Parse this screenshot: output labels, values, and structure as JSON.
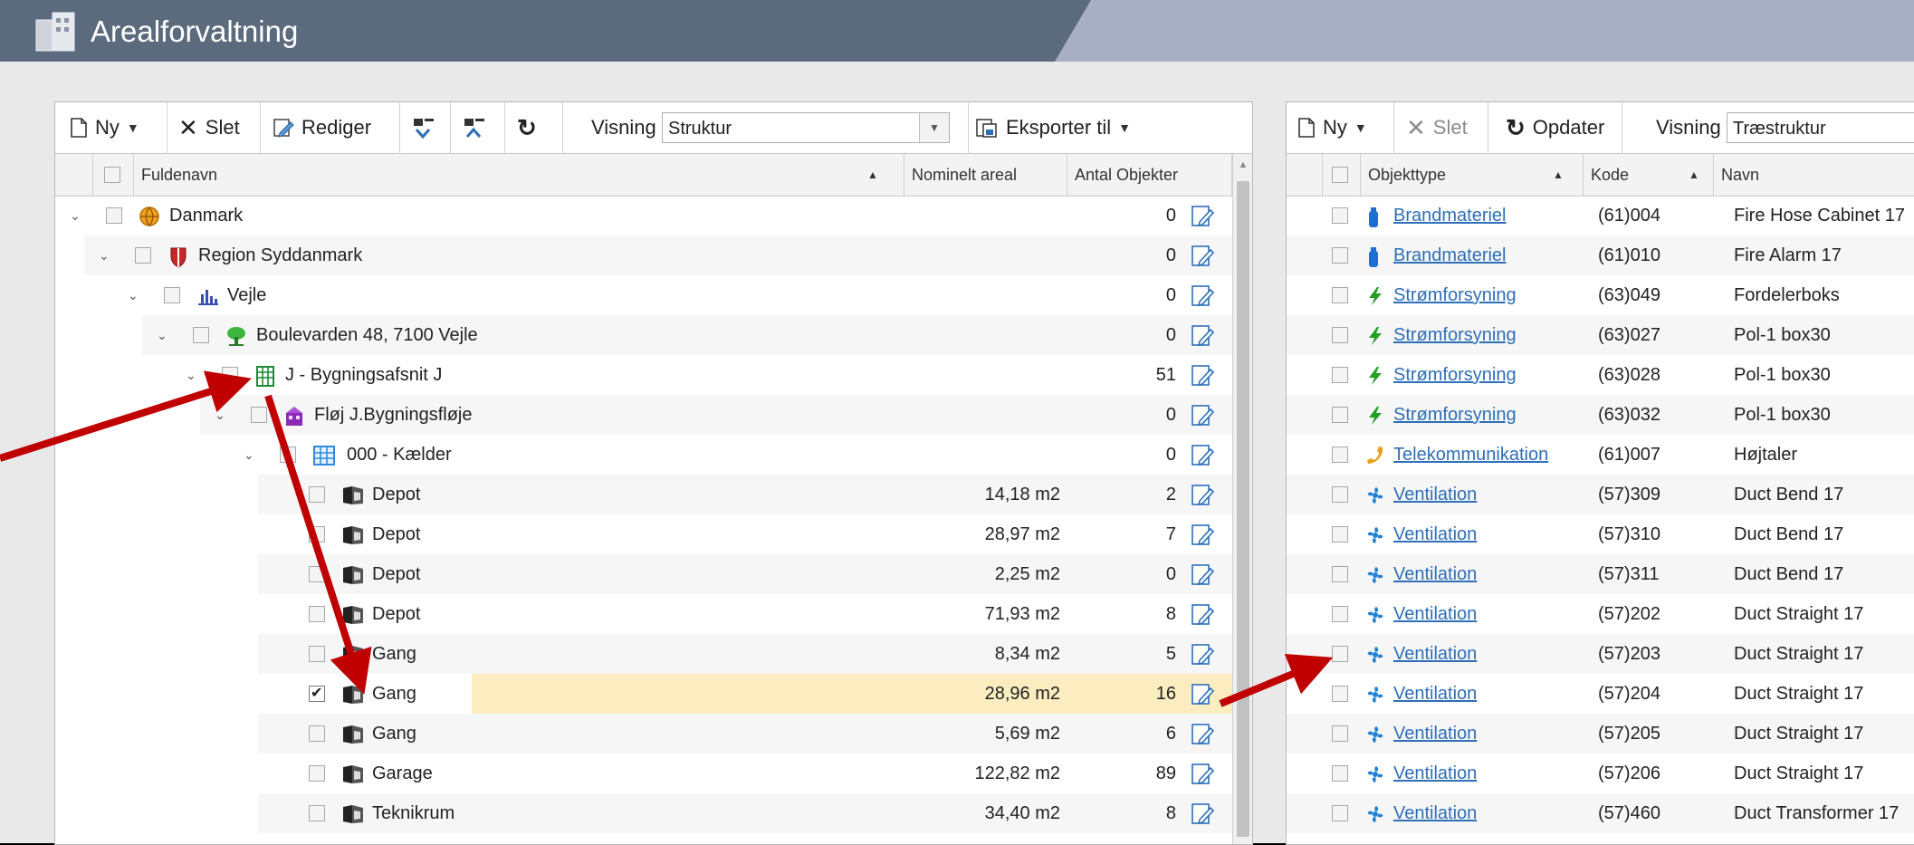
{
  "app": {
    "title": "Arealforvaltning"
  },
  "left_toolbar": {
    "new_label": "Ny",
    "delete_label": "Slet",
    "edit_label": "Rediger",
    "view_label": "Visning",
    "view_value": "Struktur",
    "export_label": "Eksporter til"
  },
  "left_table": {
    "columns": [
      "Fuldenavn",
      "Nominelt areal",
      "Antal Objekter"
    ],
    "rows": [
      {
        "name": "Danmark",
        "area": "",
        "count": "0",
        "icon": "globe-icon",
        "checked": false
      },
      {
        "name": "Region Syddanmark",
        "area": "",
        "count": "0",
        "icon": "shield-icon",
        "checked": false
      },
      {
        "name": "Vejle",
        "area": "",
        "count": "0",
        "icon": "city-icon",
        "checked": false
      },
      {
        "name": "Boulevarden 48, 7100 Vejle",
        "area": "",
        "count": "0",
        "icon": "tree-icon",
        "checked": false
      },
      {
        "name": "J - Bygningsafsnit J",
        "area": "",
        "count": "51",
        "icon": "building-icon",
        "checked": false
      },
      {
        "name": "Fløj J.Bygningsfløje",
        "area": "",
        "count": "0",
        "icon": "wing-icon",
        "checked": false
      },
      {
        "name": "000 - Kælder",
        "area": "",
        "count": "0",
        "icon": "floor-icon",
        "checked": false
      },
      {
        "name": "Depot",
        "area": "14,18 m2",
        "count": "2",
        "icon": "room-icon",
        "checked": false
      },
      {
        "name": "Depot",
        "area": "28,97 m2",
        "count": "7",
        "icon": "room-icon",
        "checked": false
      },
      {
        "name": "Depot",
        "area": "2,25 m2",
        "count": "0",
        "icon": "room-icon",
        "checked": false
      },
      {
        "name": "Depot",
        "area": "71,93 m2",
        "count": "8",
        "icon": "room-icon",
        "checked": false
      },
      {
        "name": "Gang",
        "area": "8,34 m2",
        "count": "5",
        "icon": "room-icon",
        "checked": false
      },
      {
        "name": "Gang",
        "area": "28,96 m2",
        "count": "16",
        "icon": "room-icon",
        "checked": true
      },
      {
        "name": "Gang",
        "area": "5,69 m2",
        "count": "6",
        "icon": "room-icon",
        "checked": false
      },
      {
        "name": "Garage",
        "area": "122,82 m2",
        "count": "89",
        "icon": "room-icon",
        "checked": false
      },
      {
        "name": "Teknikrum",
        "area": "34,40 m2",
        "count": "8",
        "icon": "room-icon",
        "checked": false
      }
    ]
  },
  "right_toolbar": {
    "new_label": "Ny",
    "delete_label": "Slet",
    "update_label": "Opdater",
    "view_label": "Visning",
    "view_value": "Træstruktur"
  },
  "right_table": {
    "columns": [
      "Objekttype",
      "Kode",
      "Navn"
    ],
    "rows": [
      {
        "type": "Brandmateriel",
        "code": "(61)004",
        "name": "Fire Hose Cabinet 17",
        "icon": "extinguisher-icon"
      },
      {
        "type": "Brandmateriel",
        "code": "(61)010",
        "name": "Fire Alarm 17",
        "icon": "extinguisher-icon"
      },
      {
        "type": "Strømforsyning",
        "code": "(63)049",
        "name": "Fordelerboks",
        "icon": "plug-icon"
      },
      {
        "type": "Strømforsyning",
        "code": "(63)027",
        "name": "Pol-1 box30",
        "icon": "plug-icon"
      },
      {
        "type": "Strømforsyning",
        "code": "(63)028",
        "name": "Pol-1 box30",
        "icon": "plug-icon"
      },
      {
        "type": "Strømforsyning",
        "code": "(63)032",
        "name": "Pol-1 box30",
        "icon": "plug-icon"
      },
      {
        "type": "Telekommunikation",
        "code": "(61)007",
        "name": "Højtaler",
        "icon": "phone-icon"
      },
      {
        "type": "Ventilation",
        "code": "(57)309",
        "name": "Duct Bend 17",
        "icon": "fan-icon"
      },
      {
        "type": "Ventilation",
        "code": "(57)310",
        "name": "Duct Bend 17",
        "icon": "fan-icon"
      },
      {
        "type": "Ventilation",
        "code": "(57)311",
        "name": "Duct Bend 17",
        "icon": "fan-icon"
      },
      {
        "type": "Ventilation",
        "code": "(57)202",
        "name": "Duct Straight 17",
        "icon": "fan-icon"
      },
      {
        "type": "Ventilation",
        "code": "(57)203",
        "name": "Duct Straight 17",
        "icon": "fan-icon"
      },
      {
        "type": "Ventilation",
        "code": "(57)204",
        "name": "Duct Straight 17",
        "icon": "fan-icon"
      },
      {
        "type": "Ventilation",
        "code": "(57)205",
        "name": "Duct Straight 17",
        "icon": "fan-icon"
      },
      {
        "type": "Ventilation",
        "code": "(57)206",
        "name": "Duct Straight 17",
        "icon": "fan-icon"
      },
      {
        "type": "Ventilation",
        "code": "(57)460",
        "name": "Duct Transformer 17",
        "icon": "fan-icon"
      }
    ]
  },
  "colors": {
    "titlebar": "#5b6a7d",
    "selected_row": "#fbedc0",
    "link": "#2e6fb7",
    "arrow": "#c00000"
  }
}
